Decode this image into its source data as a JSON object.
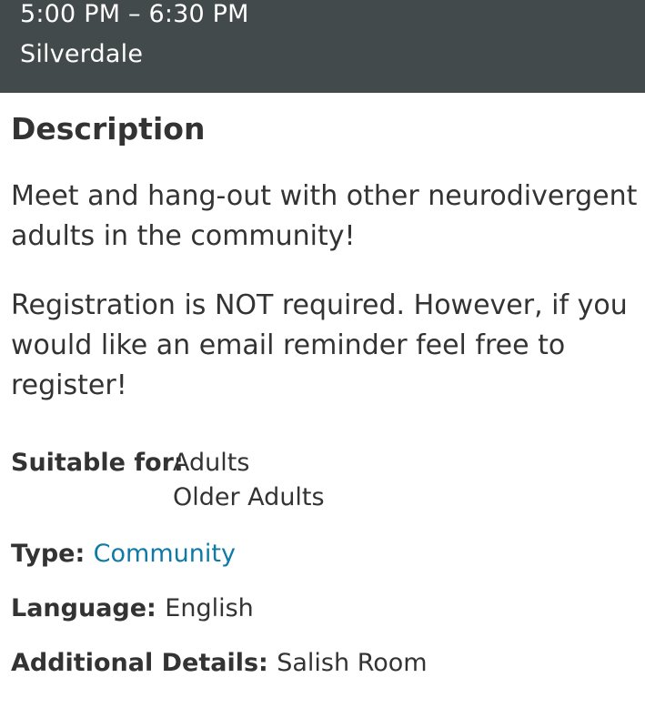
{
  "header": {
    "time": "5:00 PM – 6:30 PM",
    "location": "Silverdale"
  },
  "description": {
    "title": "Description",
    "paragraphs": [
      "Meet and hang-out with other neurodivergent adults in the community!",
      "Registration is NOT required. However, if you would like an email reminder feel free to register!"
    ]
  },
  "details": {
    "suitable_for": {
      "label": "Suitable for:",
      "values": [
        "Adults",
        "Older Adults"
      ]
    },
    "type": {
      "label": "Type:",
      "value": "Community"
    },
    "language": {
      "label": "Language:",
      "value": "English"
    },
    "additional": {
      "label": "Additional Details:",
      "value": "Salish Room"
    }
  },
  "colors": {
    "header_bg": "#434a4c",
    "link": "#0f7aa6",
    "text": "#333333"
  }
}
